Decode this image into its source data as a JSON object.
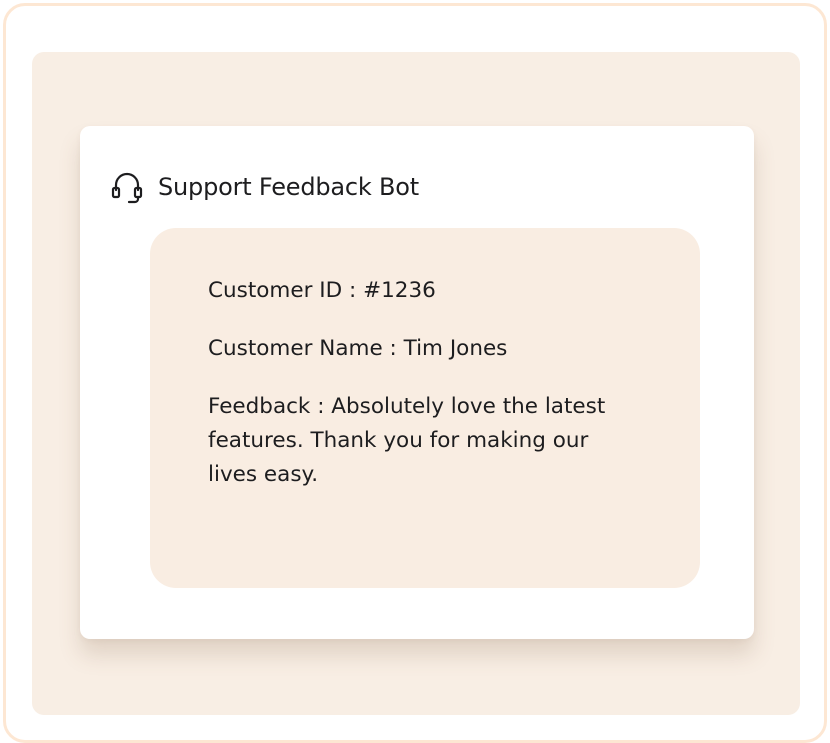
{
  "bot": {
    "title": "Support Feedback Bot",
    "icon": "headset-icon"
  },
  "message": {
    "customer_id": "Customer ID : #1236",
    "customer_name": "Customer Name : Tim Jones",
    "feedback": "Feedback : Absolutely love the latest features. Thank you for making our lives easy."
  },
  "colors": {
    "frame_border": "#fde7d3",
    "panel_background": "#f8eee4",
    "bubble_background": "#f9ede2",
    "text": "#1d1d1f"
  }
}
